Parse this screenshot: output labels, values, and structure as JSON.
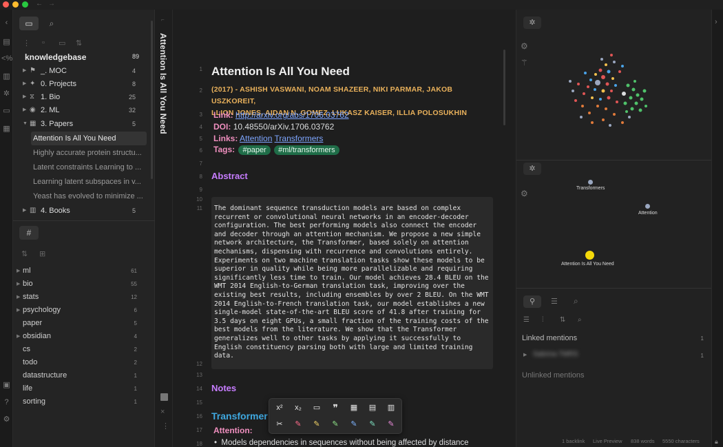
{
  "sidebar": {
    "vault_name": "knowledgebase",
    "vault_count": "89",
    "folders": [
      {
        "label": "_. MOC",
        "count": "4",
        "expanded": false
      },
      {
        "label": "0. Projects",
        "count": "8",
        "expanded": false
      },
      {
        "label": "1. Bio",
        "count": "25",
        "expanded": false
      },
      {
        "label": "2. ML",
        "count": "32",
        "expanded": false
      },
      {
        "label": "3. Papers",
        "count": "5",
        "expanded": true
      },
      {
        "label": "4. Books",
        "count": "5",
        "expanded": false
      }
    ],
    "files": [
      "Attention Is All You Need",
      "Highly accurate protein structu...",
      "Latent constraints Learning to ...",
      "Learning latent subspaces in v...",
      "Yeast has evolved to minimize ..."
    ],
    "tag_panel_icon": "#",
    "tags": [
      {
        "label": "ml",
        "count": "61",
        "has_children": true
      },
      {
        "label": "bio",
        "count": "55",
        "has_children": true
      },
      {
        "label": "stats",
        "count": "12",
        "has_children": true
      },
      {
        "label": "psychology",
        "count": "6",
        "has_children": true
      },
      {
        "label": "paper",
        "count": "5",
        "has_children": false
      },
      {
        "label": "obsidian",
        "count": "4",
        "has_children": true
      },
      {
        "label": "cs",
        "count": "2",
        "has_children": false
      },
      {
        "label": "todo",
        "count": "2",
        "has_children": false
      },
      {
        "label": "datastructure",
        "count": "1",
        "has_children": false
      },
      {
        "label": "life",
        "count": "1",
        "has_children": false
      },
      {
        "label": "sorting",
        "count": "1",
        "has_children": false
      }
    ]
  },
  "note": {
    "vertical_title": "Attention Is All You Need",
    "title": "Attention Is All You Need",
    "authors_line1": "(2017) - ASHISH VASWANI, NOAM SHAZEER, NIKI PARMAR, JAKOB USZKOREIT,",
    "authors_line2": "LLION JONES, AIDAN N. GOMEZ, LUKASZ KAISER, ILLIA POLOSUKHIN",
    "link_key": "Link",
    "link_value": "http://arxiv.org/abs/1706.03762",
    "doi_key": "DOI",
    "doi_value": "10.48550/arXiv.1706.03762",
    "links_key": "Links",
    "links_1": "Attention",
    "links_2": "Transformers",
    "tags_key": "Tags",
    "tag_1": "#paper",
    "tag_2": "#ml/transformers",
    "abstract_heading": "Abstract",
    "abstract_text": "The dominant sequence transduction models are based on complex\nrecurrent or convolutional neural networks in an encoder-decoder\nconfiguration. The best performing models also connect the encoder\nand decoder through an attention mechanism. We propose a new simple\nnetwork architecture, the Transformer, based solely on attention\nmechanisms, dispensing with recurrence and convolutions entirely.\nExperiments on two machine translation tasks show these models to be\nsuperior in quality while being more parallelizable and requiring\nsignificantly less time to train. Our model achieves 28.4 BLEU on the\nWMT 2014 English-to-German translation task, improving over the\nexisting best results, including ensembles by over 2 BLEU. On the WMT\n2014 English-to-French translation task, our model establishes a new\nsingle-model state-of-the-art BLEU score of 41.8 after training for\n3.5 days on eight GPUs, a small fraction of the training costs of the\nbest models from the literature. We show that the Transformer\ngeneralizes well to other tasks by applying it successfully to\nEnglish constituency parsing both with large and limited training\ndata.",
    "notes_heading": "Notes",
    "transformer_heading": "Transformer",
    "attention_label": "Attention:",
    "bullet_1": "Models dependencies in sequences without being affected by distance",
    "line_numbers": [
      "1",
      "2",
      "3",
      "4",
      "5",
      "6",
      "7",
      "8",
      "9",
      "10",
      "11",
      "12",
      "13",
      "14",
      "15",
      "16",
      "17",
      "18"
    ]
  },
  "local_graph": {
    "labels": [
      "Transformers",
      "Attention",
      "Attention Is All You Need"
    ]
  },
  "backlinks": {
    "linked_label": "Linked mentions",
    "linked_count": "1",
    "item_count": "1",
    "item_label": "Sabrina TMRS",
    "unlinked_label": "Unlinked mentions"
  },
  "status": {
    "backlinks": "1 backlink",
    "mode": "Live Preview",
    "words": "838 words",
    "chars": "5550 characters"
  },
  "toolbar": {
    "superscript": "x²",
    "subscript": "x₂",
    "quote": "❞"
  },
  "colors": {
    "authors": "#e9b15b",
    "meta_key": "#f08fbf",
    "link": "#7ea6ff",
    "tag_pill": "#1f6d48",
    "h2": "#c77dff",
    "h3": "#3fa8e0",
    "active_node": "#f5d90a"
  }
}
